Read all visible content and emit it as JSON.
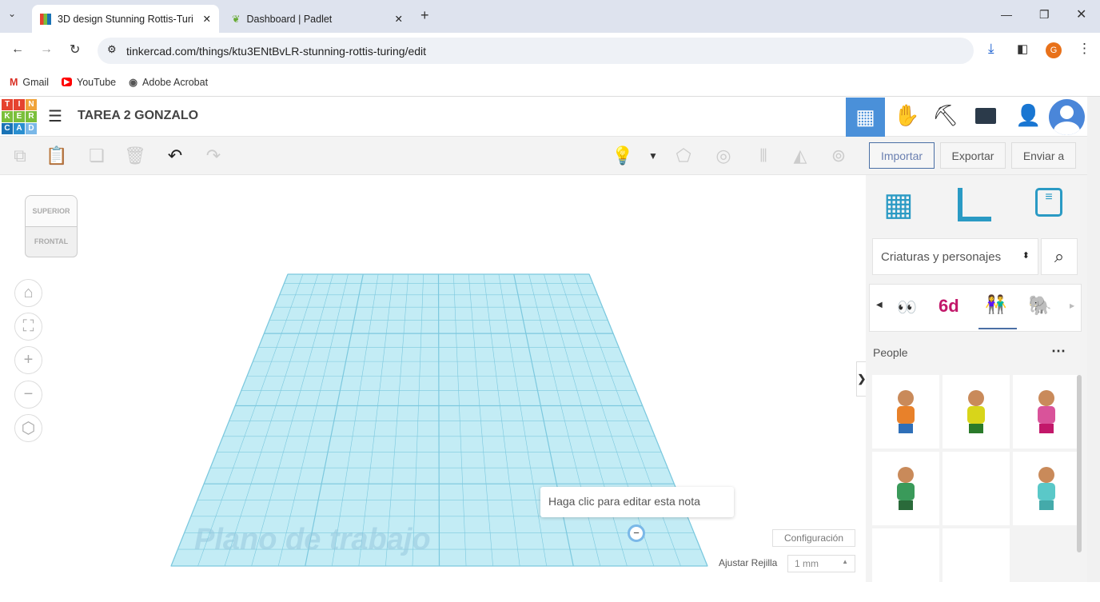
{
  "browser": {
    "tabs": [
      {
        "title": "3D design Stunning Rottis-Turi",
        "active": true
      },
      {
        "title": "Dashboard | Padlet",
        "active": false
      }
    ],
    "url": "tinkercad.com/things/ktu3ENtBvLR-stunning-rottis-turing/edit",
    "bookmarks": [
      "Gmail",
      "YouTube",
      "Adobe Acrobat"
    ],
    "profile_initial": "G"
  },
  "app": {
    "logo": [
      "T",
      "I",
      "N",
      "K",
      "E",
      "R",
      "C",
      "A",
      "D"
    ],
    "title": "TAREA 2 GONZALO",
    "buttons": {
      "import": "Importar",
      "export": "Exportar",
      "send": "Enviar a"
    },
    "viewcube": {
      "top": "SUPERIOR",
      "front": "FRONTAL"
    },
    "panel": {
      "category": "Criaturas y personajes",
      "section": "People"
    },
    "workplane_label": "Plano de trabajo",
    "note": "Haga clic para editar esta nota",
    "settings": "Configuración",
    "snap_label": "Ajustar Rejilla",
    "snap_value": "1 mm"
  },
  "colors": {
    "accent": "#4a90d9",
    "grid": "#8fd6e8"
  }
}
